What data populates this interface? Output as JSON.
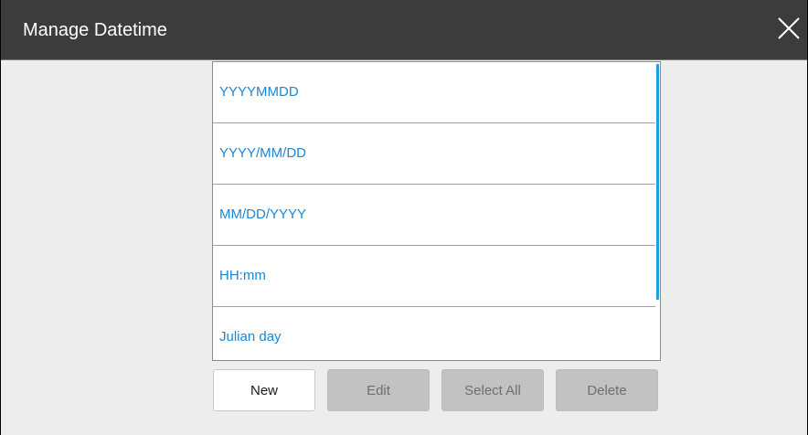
{
  "window": {
    "title": "Manage Datetime"
  },
  "list": {
    "items": [
      {
        "label": "YYYYMMDD"
      },
      {
        "label": "YYYY/MM/DD"
      },
      {
        "label": "MM/DD/YYYY"
      },
      {
        "label": "HH:mm"
      },
      {
        "label": "Julian day"
      }
    ]
  },
  "buttons": {
    "new_label": "New",
    "edit_label": "Edit",
    "select_all_label": "Select All",
    "delete_label": "Delete"
  },
  "colors": {
    "titlebar": "#3c3c3c",
    "background": "#ededed",
    "item_text": "#1c86d6",
    "scrollbar": "#16a2e6",
    "disabled_button": "#c2c2c2"
  },
  "icons": {
    "close": "close-icon"
  }
}
